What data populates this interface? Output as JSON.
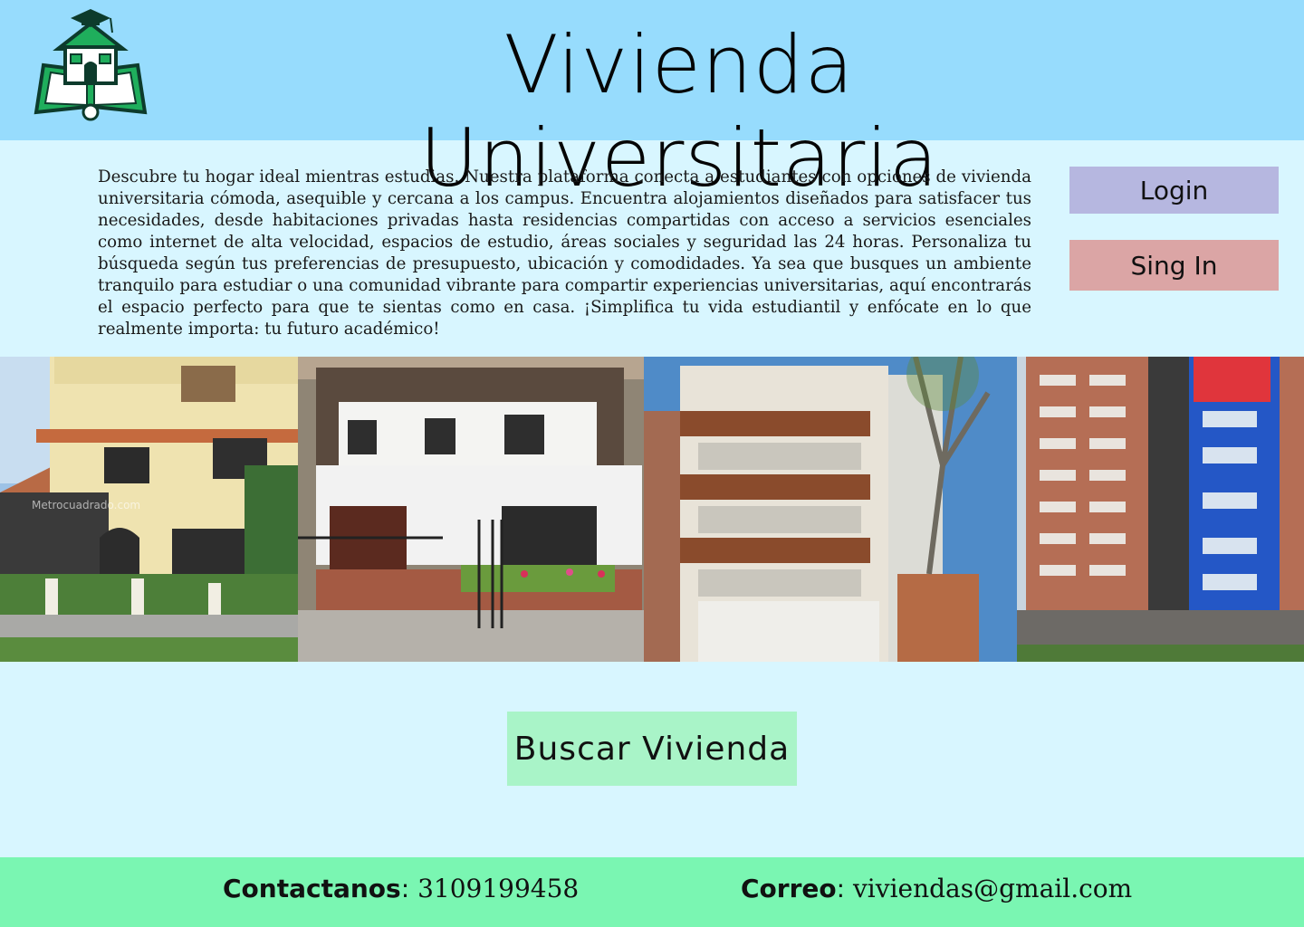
{
  "header": {
    "title": "Vivienda Universitaria",
    "logo_icon": "house-book-logo-icon"
  },
  "intro": {
    "text": "Descubre tu hogar ideal mientras estudias. Nuestra plataforma conecta a estudiantes con opciones de vivienda universitaria cómoda, asequible y cercana a los campus. Encuentra alojamientos diseñados para satisfacer tus necesidades, desde habitaciones privadas hasta residencias compartidas con acceso a servicios esenciales como internet de alta velocidad, espacios de estudio, áreas sociales y seguridad las 24 horas. Personaliza tu búsqueda según tus preferencias de presupuesto, ubicación y comodidades. Ya sea que busques un ambiente tranquilo para estudiar o una comunidad vibrante para compartir experiencias universitarias, aquí encontrarás el espacio perfecto para que te sientas como en casa. ¡Simplifica tu vida estudiantil y enfócate en lo que realmente importa: tu futuro académico!"
  },
  "auth": {
    "login_label": "Login",
    "signin_label": "Sing In"
  },
  "gallery": {
    "watermark": "Metrocuadrado.com"
  },
  "search": {
    "label": "Buscar Vivienda"
  },
  "footer": {
    "contact_label": "Contactanos",
    "contact_value": "3109199458",
    "mail_label": "Correo",
    "mail_value": "viviendas@gmail.com"
  },
  "colors": {
    "header_bg": "#97dcfd",
    "page_bg": "#d8f6ff",
    "login_bg": "#b6b7e0",
    "signin_bg": "#dba5a5",
    "search_bg": "#a9f4c8",
    "footer_bg": "#7af6b2"
  }
}
